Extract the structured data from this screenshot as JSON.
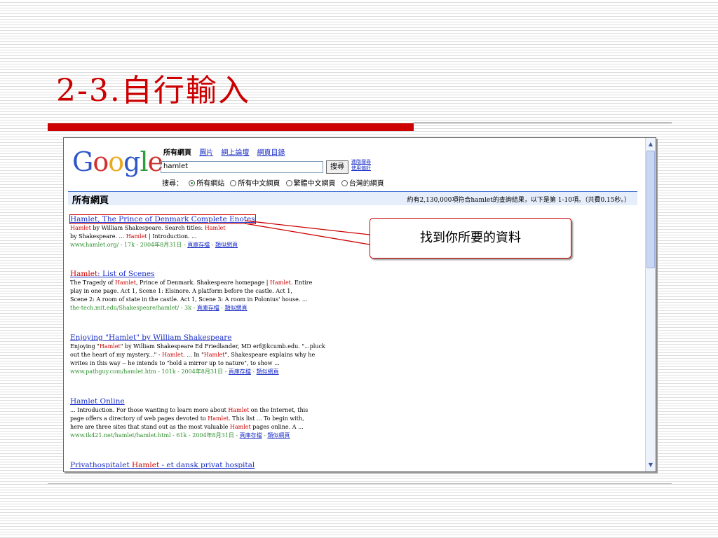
{
  "slide": {
    "title": "2-3.自行輸入"
  },
  "logo": {
    "g1": "G",
    "o1": "o",
    "o2": "o",
    "g2": "g",
    "l": "l",
    "e": "e"
  },
  "nav": {
    "active": "所有網頁",
    "links": [
      "圖片",
      "網上論壇",
      "網頁目錄"
    ]
  },
  "search": {
    "query": "hamlet",
    "button": "搜尋",
    "advanced": "進階搜尋",
    "preferences": "使用偏好",
    "scope_label": "搜尋：",
    "scope_options": [
      "所有網站",
      "所有中文網頁",
      "繁體中文網頁",
      "台灣的網頁"
    ],
    "scope_selected": 0
  },
  "results_bar": {
    "title": "所有網頁",
    "stats": "約有2,130,000項符合hamlet的查詢結果，以下是第 1-10項。（共費0.15秒。）"
  },
  "results": [
    {
      "title": [
        {
          "t": "Hamlet, The Prince of Denmark Complete Enotes"
        }
      ],
      "snippet": [
        [
          {
            "t": "Hamlet",
            "hl": true
          },
          {
            "t": " by William Shakespeare. Search titles: "
          },
          {
            "t": "Hamlet",
            "hl": true
          }
        ],
        [
          {
            "t": "by Shakespeare. ... "
          },
          {
            "t": "Hamlet",
            "hl": true
          },
          {
            "t": " | Introduction. ..."
          }
        ]
      ],
      "url": "www.hamlet.org/ - 17k - 2004年8月31日 - ",
      "cached": "頁庫存檔",
      "similar": "類似網頁"
    },
    {
      "title": [
        {
          "t": "Hamlet",
          "hl": true
        },
        {
          "t": ": List of Scenes"
        }
      ],
      "snippet": [
        [
          {
            "t": "The Tragedy of "
          },
          {
            "t": "Hamlet",
            "hl": true
          },
          {
            "t": ", Prince of Denmark. Shakespeare homepage | "
          },
          {
            "t": "Hamlet",
            "hl": true
          },
          {
            "t": ". Entire"
          }
        ],
        [
          {
            "t": "play in one page. Act 1, Scene 1: Elsinore. A platform before the castle. Act 1,"
          }
        ],
        [
          {
            "t": "Scene 2: A room of state in the castle. Act 1, Scene 3: A room in Polonius' house. ..."
          }
        ]
      ],
      "url": "the-tech.mit.edu/Shakespeare/hamlet/ - 3k - ",
      "cached": "頁庫存檔",
      "similar": "類似網頁"
    },
    {
      "title": [
        {
          "t": "Enjoying \"Hamlet\" by William Shakespeare"
        }
      ],
      "snippet": [
        [
          {
            "t": "Enjoying \""
          },
          {
            "t": "Hamlet",
            "hl": true
          },
          {
            "t": "\" by William Shakespeare Ed Friedlander, MD erf@kcumb.edu. \"...pluck"
          }
        ],
        [
          {
            "t": "out the heart of my mystery...\" - "
          },
          {
            "t": "Hamlet",
            "hl": true
          },
          {
            "t": ". ... In \""
          },
          {
            "t": "Hamlet",
            "hl": true
          },
          {
            "t": "\", Shakespeare explains why he"
          }
        ],
        [
          {
            "t": "writes in this way -- he intends to \"hold a mirror up to nature\", to show ..."
          }
        ]
      ],
      "url": "www.pathguy.com/hamlet.htm - 101k - 2004年8月31日 - ",
      "cached": "頁庫存檔",
      "similar": "類似網頁"
    },
    {
      "title": [
        {
          "t": "Hamlet Online"
        }
      ],
      "snippet": [
        [
          {
            "t": "... Introduction. For those wanting to learn more about "
          },
          {
            "t": "Hamlet",
            "hl": true
          },
          {
            "t": " on the Internet, this"
          }
        ],
        [
          {
            "t": "page offers a directory of web pages devoted to "
          },
          {
            "t": "Hamlet",
            "hl": true
          },
          {
            "t": ". This list ... To begin with,"
          }
        ],
        [
          {
            "t": "here are three sites that stand out as the most valuable "
          },
          {
            "t": "Hamlet",
            "hl": true
          },
          {
            "t": " pages online. A ..."
          }
        ]
      ],
      "url": "www.tk421.net/hamlet/hamlet.html - 61k - 2004年8月31日 - ",
      "cached": "頁庫存檔",
      "similar": "類似網頁"
    },
    {
      "title": [
        {
          "t": "Privathospitalet "
        },
        {
          "t": "Hamlet",
          "hl": true
        },
        {
          "t": " - et dansk privat hospital"
        }
      ],
      "snippet": [],
      "url": "",
      "cached": "",
      "similar": ""
    }
  ],
  "callout": {
    "text": "找到你所要的資料"
  },
  "colors": {
    "accent": "#cc0000",
    "link": "#1b2fc6",
    "url": "#2d8f2d",
    "bar": "#e6eefc"
  }
}
